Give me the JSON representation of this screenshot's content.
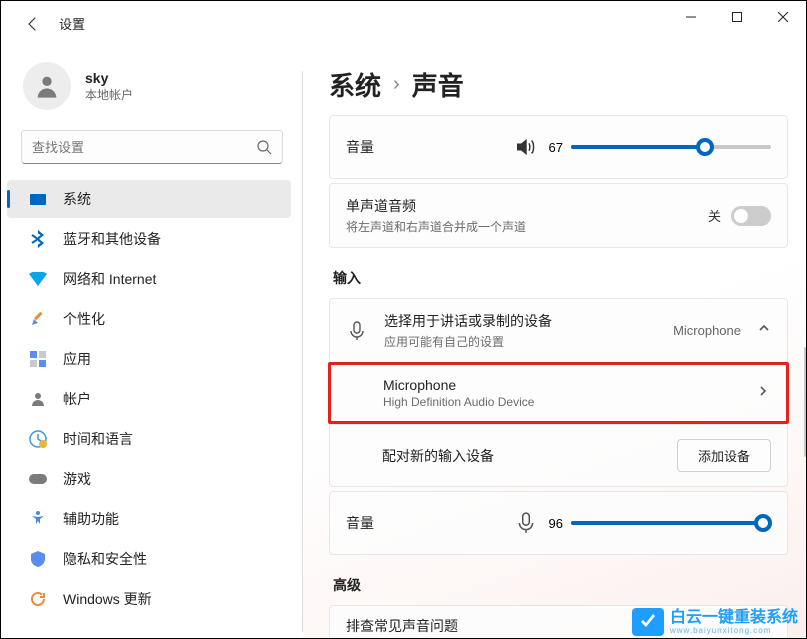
{
  "window": {
    "title": "设置"
  },
  "user": {
    "name": "sky",
    "subtitle": "本地帐户"
  },
  "search": {
    "placeholder": "查找设置"
  },
  "nav": {
    "system": "系统",
    "bluetooth": "蓝牙和其他设备",
    "network": "网络和 Internet",
    "personalization": "个性化",
    "apps": "应用",
    "accounts": "帐户",
    "time": "时间和语言",
    "gaming": "游戏",
    "accessibility": "辅助功能",
    "privacy": "隐私和安全性",
    "update": "Windows 更新"
  },
  "breadcrumb": {
    "parent": "系统",
    "current": "声音"
  },
  "output": {
    "volume_label": "音量",
    "volume_value": "67",
    "volume_percent": 67,
    "mono_title": "单声道音频",
    "mono_sub": "将左声道和右声道合并成一个声道",
    "mono_state": "关"
  },
  "input_section": {
    "heading": "输入",
    "choose_title": "选择用于讲话或录制的设备",
    "choose_sub": "应用可能有自己的设置",
    "choose_value": "Microphone",
    "mic_name": "Microphone",
    "mic_sub": "High Definition Audio Device",
    "pair_label": "配对新的输入设备",
    "pair_button": "添加设备",
    "volume_label": "音量",
    "volume_value": "96",
    "volume_percent": 96
  },
  "advanced": {
    "heading": "高级",
    "troubleshoot": "排查常见声音问题"
  },
  "watermark": {
    "brand": "白云一键重装系统",
    "url": "www.baiyunxitong.com"
  }
}
